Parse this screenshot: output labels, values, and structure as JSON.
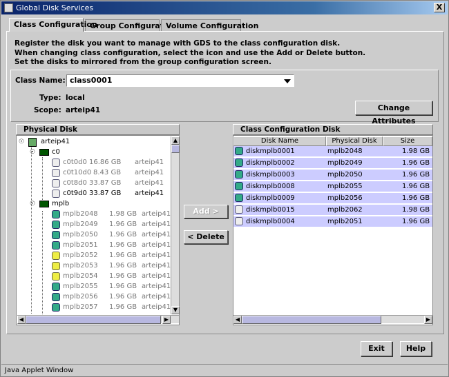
{
  "window": {
    "title": "Global Disk Services",
    "close_glyph": "X"
  },
  "tabs": [
    {
      "label": "Class Configuration",
      "active": true
    },
    {
      "label": "Group Configuration",
      "active": false
    },
    {
      "label": "Volume Configuration",
      "active": false
    }
  ],
  "instructions": [
    "Register the disk you want to manage with GDS to the class configuration disk.",
    "When changing class configuration, select the icon and use the Add or Delete button.",
    "Set the disks to mirrored from the group configuration screen."
  ],
  "class": {
    "name_label": "Class Name:",
    "name_value": "class0001",
    "type_label": "Type:",
    "type_value": "local",
    "scope_label": "Scope:",
    "scope_value": "arteip41",
    "change_button": "Change Attributes"
  },
  "physical_disk": {
    "title": "Physical Disk",
    "host": "arteip41",
    "controllers": [
      {
        "name": "c0",
        "disks": [
          {
            "name": "c0t0d0",
            "size": "16.86 GB",
            "host": "arteip41",
            "dim": true,
            "icon": "disk-gray"
          },
          {
            "name": "c0t10d0",
            "size": "8.43 GB",
            "host": "arteip41",
            "dim": true,
            "icon": "disk-gray"
          },
          {
            "name": "c0t8d0",
            "size": "33.87 GB",
            "host": "arteip41",
            "dim": true,
            "icon": "disk-gray"
          },
          {
            "name": "c0t9d0",
            "size": "33.87 GB",
            "host": "arteip41",
            "dim": false,
            "icon": "disk-gray"
          }
        ]
      },
      {
        "name": "mplb",
        "disks": [
          {
            "name": "mplb2048",
            "size": "1.98 GB",
            "host": "arteip41:",
            "dim": true,
            "icon": "disk-green"
          },
          {
            "name": "mplb2049",
            "size": "1.96 GB",
            "host": "arteip41:",
            "dim": true,
            "icon": "disk-green"
          },
          {
            "name": "mplb2050",
            "size": "1.96 GB",
            "host": "arteip41:",
            "dim": true,
            "icon": "disk-green"
          },
          {
            "name": "mplb2051",
            "size": "1.96 GB",
            "host": "arteip41:",
            "dim": true,
            "icon": "disk-green"
          },
          {
            "name": "mplb2052",
            "size": "1.96 GB",
            "host": "arteip41:",
            "dim": true,
            "icon": "disk-yellow"
          },
          {
            "name": "mplb2053",
            "size": "1.96 GB",
            "host": "arteip41:",
            "dim": true,
            "icon": "disk-yellow"
          },
          {
            "name": "mplb2054",
            "size": "1.96 GB",
            "host": "arteip41:",
            "dim": true,
            "icon": "disk-yellow"
          },
          {
            "name": "mplb2055",
            "size": "1.96 GB",
            "host": "arteip41:",
            "dim": true,
            "icon": "disk-green"
          },
          {
            "name": "mplb2056",
            "size": "1.96 GB",
            "host": "arteip41:",
            "dim": true,
            "icon": "disk-green"
          },
          {
            "name": "mplb2057",
            "size": "1.96 GB",
            "host": "arteip41:",
            "dim": true,
            "icon": "disk-green"
          }
        ]
      }
    ]
  },
  "buttons": {
    "add": "Add >",
    "delete": "< Delete",
    "exit": "Exit",
    "help": "Help"
  },
  "class_config_disk": {
    "title": "Class Configuration Disk",
    "columns": [
      "Disk Name",
      "Physical Disk",
      "Size"
    ],
    "rows": [
      {
        "disk": "diskmplb0001",
        "physical": "mplb2048",
        "size": "1.98 GB"
      },
      {
        "disk": "diskmplb0002",
        "physical": "mplb2049",
        "size": "1.96 GB"
      },
      {
        "disk": "diskmplb0003",
        "physical": "mplb2050",
        "size": "1.96 GB"
      },
      {
        "disk": "diskmplb0008",
        "physical": "mplb2055",
        "size": "1.96 GB"
      },
      {
        "disk": "diskmplb0009",
        "physical": "mplb2056",
        "size": "1.96 GB"
      },
      {
        "disk": "diskmplb0015",
        "physical": "mplb2062",
        "size": "1.98 GB"
      },
      {
        "disk": "diskmplb0004",
        "physical": "mplb2051",
        "size": "1.96 GB"
      }
    ]
  },
  "status_bar": "Java Applet Window"
}
